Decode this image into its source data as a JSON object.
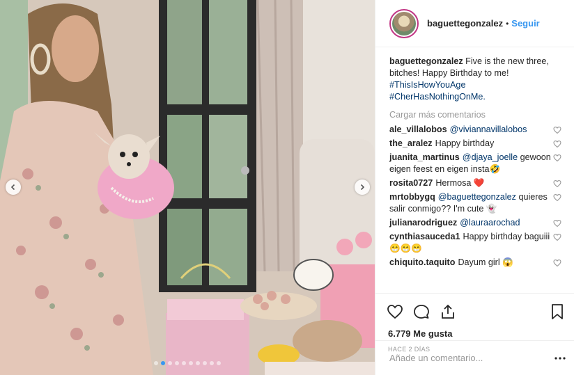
{
  "header": {
    "username": "baguettegonzalez",
    "separator": "•",
    "follow_label": "Seguir"
  },
  "caption": {
    "username": "baguettegonzalez",
    "text": "Five is the new three, bitches! Happy Birthday to me!",
    "hashtags": [
      "#ThisIsHowYouAge",
      "#CherHasNothingOnMe."
    ]
  },
  "load_more_label": "Cargar más comentarios",
  "comments": [
    {
      "user": "ale_villalobos",
      "mention": "@viviannavillalobos",
      "text": ""
    },
    {
      "user": "the_aralez",
      "mention": "",
      "text": "Happy birthday"
    },
    {
      "user": "juanita_martinus",
      "mention": "@djaya_joelle",
      "text": "gewoon eigen feest en eigen insta🤣"
    },
    {
      "user": "rosita0727",
      "mention": "",
      "text": "Hermosa ❤️"
    },
    {
      "user": "mrtobbygq",
      "mention": "@baguettegonzalez",
      "text": "quieres salir conmigo?? I'm cute 👻"
    },
    {
      "user": "julianarodriguez",
      "mention": "@lauraarochad",
      "text": ""
    },
    {
      "user": "cynthiasauceda1",
      "mention": "",
      "text": "Happy birthday baguiii 😁😁😁"
    },
    {
      "user": "chiquito.taquito",
      "mention": "",
      "text": "Dayum girl 😱"
    }
  ],
  "likes": "6.779 Me gusta",
  "date": "HACE 2 DÍAS",
  "comment_input": {
    "placeholder": "Añade un comentario..."
  },
  "carousel": {
    "count": 10,
    "active_index": 1
  },
  "colors": {
    "link": "#3897f0",
    "hashtag": "#003569",
    "muted": "#999999"
  }
}
